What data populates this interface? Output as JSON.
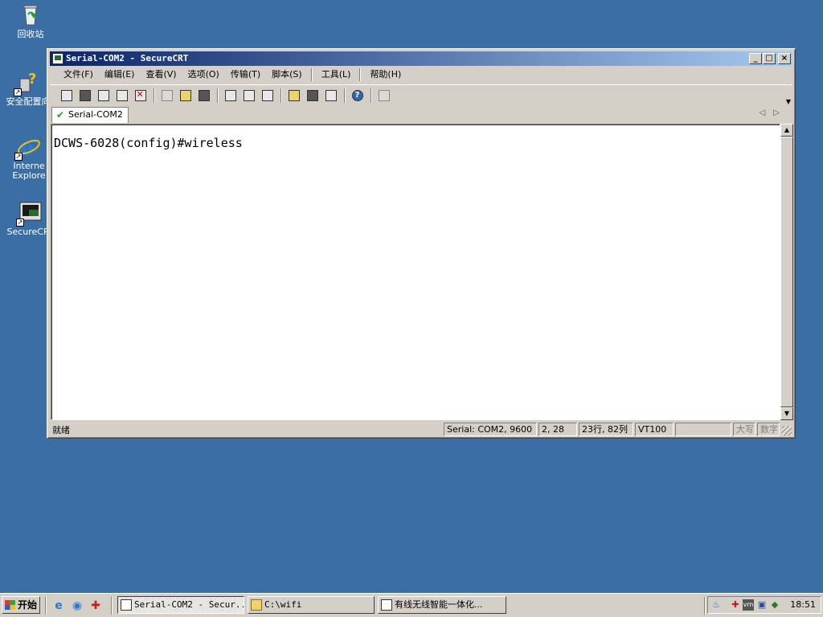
{
  "desktop": {
    "icons": [
      {
        "label": "回收站"
      },
      {
        "label": "安全配置向"
      },
      {
        "label": "Interne"
      },
      {
        "label": "Explore"
      },
      {
        "label": "SecureCRT"
      }
    ]
  },
  "window": {
    "title": "Serial-COM2 - SecureCRT",
    "controls": {
      "minimize": "_",
      "maximize": "□",
      "close": "×"
    },
    "menu": [
      "文件(F)",
      "编辑(E)",
      "查看(V)",
      "选项(O)",
      "传输(T)",
      "脚本(S)",
      "工具(L)",
      "帮助(H)"
    ],
    "tab": {
      "label": "Serial-COM2"
    },
    "terminal": {
      "lines": [
        "DCWS-6028(config)#wireless"
      ]
    },
    "status": {
      "text": "就绪",
      "connection": "Serial: COM2, 9600",
      "cursor": "2,  28",
      "size": "23行, 82列",
      "emulation": "VT100",
      "blank": "",
      "caps": "大写",
      "num": "数字"
    }
  },
  "taskbar": {
    "start_label": "开始",
    "tasks": [
      {
        "label": "Serial-COM2 - Secur..."
      },
      {
        "label": "C:\\wifi"
      },
      {
        "label": "有线无线智能一体化..."
      }
    ],
    "clock": "18:51"
  },
  "colors": {
    "desktop": "#3a6ea5",
    "titlebar_start": "#0a246a",
    "titlebar_end": "#a6caf0",
    "chrome": "#d4d0c8"
  }
}
